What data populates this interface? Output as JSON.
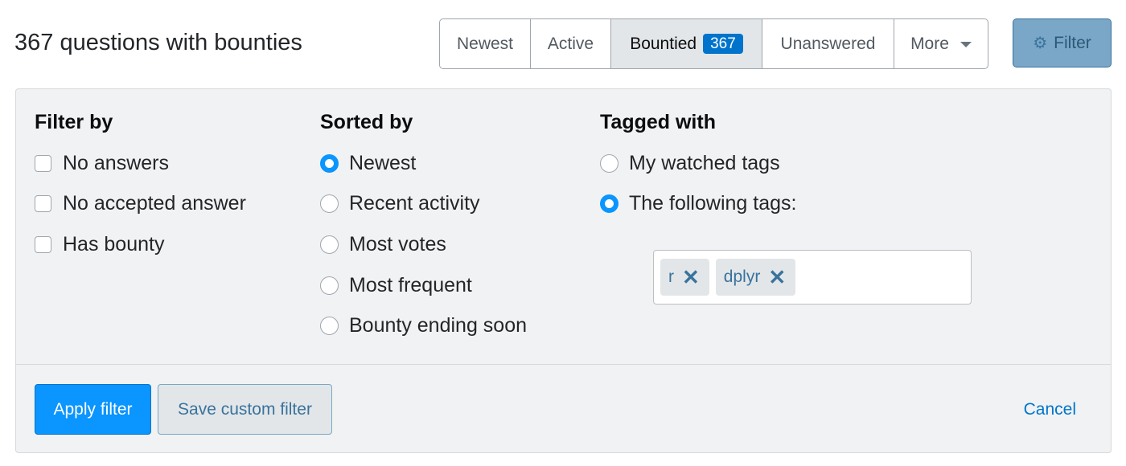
{
  "header": {
    "title": "367 questions with bounties",
    "tabs": [
      {
        "label": "Newest",
        "selected": false
      },
      {
        "label": "Active",
        "selected": false
      },
      {
        "label": "Bountied",
        "badge": "367",
        "selected": true
      },
      {
        "label": "Unanswered",
        "selected": false
      },
      {
        "label": "More",
        "selected": false,
        "icon": "caret-down-icon"
      }
    ],
    "filter_button": {
      "label": "Filter",
      "icon": "gear-icon",
      "active": true
    }
  },
  "filter_panel": {
    "filter_by": {
      "heading": "Filter by",
      "options": [
        {
          "label": "No answers",
          "checked": false
        },
        {
          "label": "No accepted answer",
          "checked": false
        },
        {
          "label": "Has bounty",
          "checked": false
        }
      ]
    },
    "sorted_by": {
      "heading": "Sorted by",
      "selected": "Newest",
      "options": [
        {
          "label": "Newest",
          "checked": true
        },
        {
          "label": "Recent activity",
          "checked": false
        },
        {
          "label": "Most votes",
          "checked": false
        },
        {
          "label": "Most frequent",
          "checked": false
        },
        {
          "label": "Bounty ending soon",
          "checked": false
        }
      ]
    },
    "tagged_with": {
      "heading": "Tagged with",
      "options": [
        {
          "label": "My watched tags",
          "checked": false
        },
        {
          "label": "The following tags:",
          "checked": true
        }
      ],
      "tags": [
        {
          "label": "r",
          "remove_icon": "close-icon"
        },
        {
          "label": "dplyr",
          "remove_icon": "close-icon"
        }
      ]
    },
    "footer": {
      "apply_label": "Apply filter",
      "save_label": "Save custom filter",
      "cancel_label": "Cancel"
    }
  },
  "colors": {
    "accent": "#0a95ff",
    "link": "#0074cc",
    "filter_button_bg": "#7aa7c7",
    "panel_bg": "#f1f2f3"
  }
}
